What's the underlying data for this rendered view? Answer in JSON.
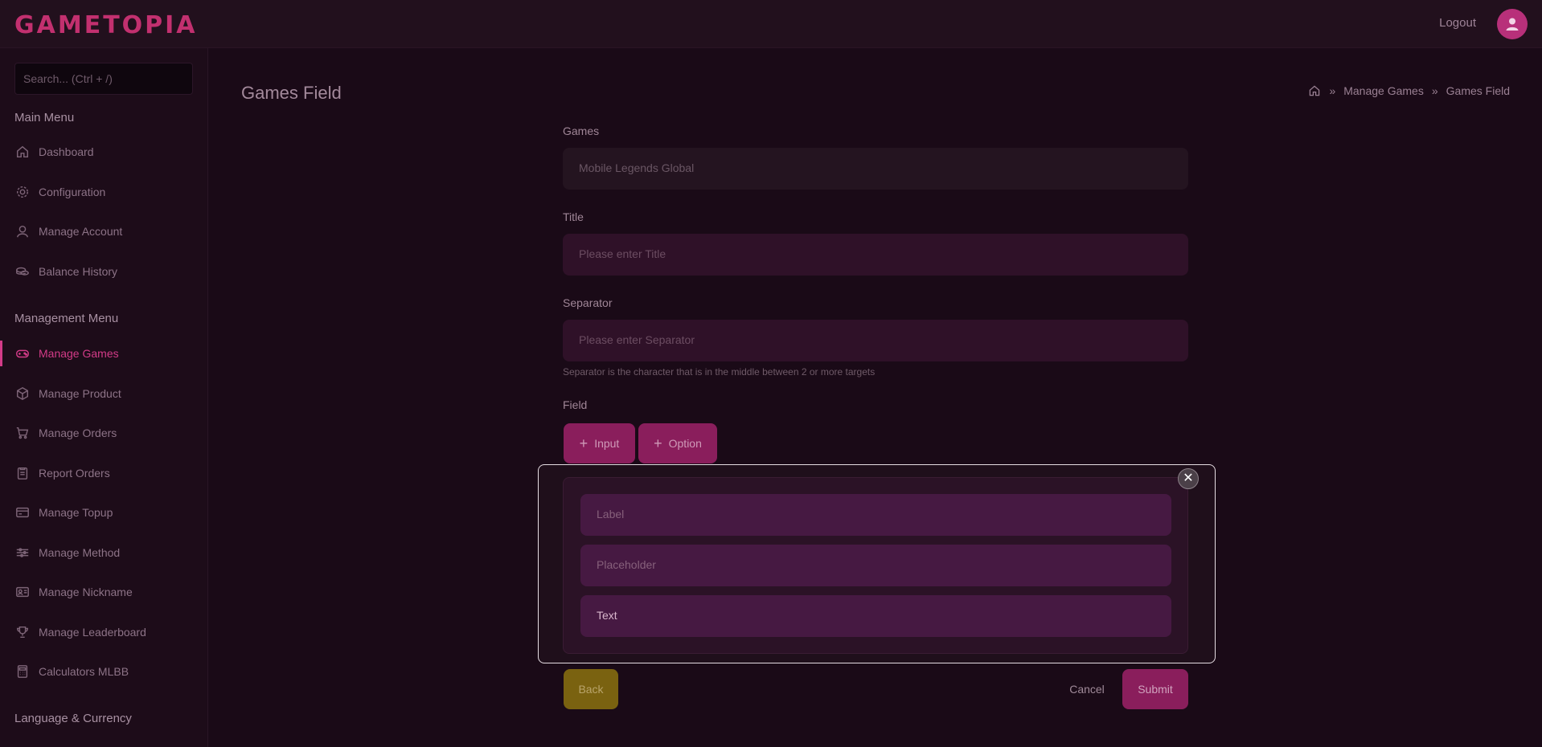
{
  "header": {
    "logo": "GAMETOPIA",
    "logout_label": "Logout",
    "avatar_icon": "user-icon"
  },
  "sidebar": {
    "search_placeholder": "Search... (Ctrl + /)",
    "main_menu_heading": "Main Menu",
    "main_items": [
      {
        "label": "Dashboard",
        "icon": "home-icon"
      },
      {
        "label": "Configuration",
        "icon": "gear-icon"
      },
      {
        "label": "Manage Account",
        "icon": "user-icon"
      },
      {
        "label": "Balance History",
        "icon": "coins-icon"
      }
    ],
    "management_heading": "Management Menu",
    "management_items": [
      {
        "label": "Manage Games",
        "icon": "gamepad-icon",
        "active": true
      },
      {
        "label": "Manage Product",
        "icon": "box-icon"
      },
      {
        "label": "Manage Orders",
        "icon": "cart-icon"
      },
      {
        "label": "Report Orders",
        "icon": "clipboard-icon"
      },
      {
        "label": "Manage Topup",
        "icon": "card-icon"
      },
      {
        "label": "Manage Method",
        "icon": "sliders-icon"
      },
      {
        "label": "Manage Nickname",
        "icon": "id-card-icon"
      },
      {
        "label": "Manage Leaderboard",
        "icon": "trophy-icon"
      },
      {
        "label": "Calculators MLBB",
        "icon": "calculator-icon"
      }
    ],
    "language_heading": "Language & Currency"
  },
  "main": {
    "page_title": "Games Field",
    "breadcrumb": [
      "Manage Games",
      "Games Field"
    ],
    "games_label": "Games",
    "games_value": "Mobile Legends Global",
    "title_label": "Title",
    "title_placeholder": "Please enter Title",
    "separator_label": "Separator",
    "separator_placeholder": "Please enter Separator",
    "separator_hint": "Separator is the character that is in the middle between 2 or more targets",
    "field_label": "Field",
    "add_input_label": "Input",
    "add_option_label": "Option",
    "field_row": {
      "label_placeholder": "Label",
      "placeholder_placeholder": "Placeholder",
      "type_value": "Text",
      "close_symbol": "✕"
    },
    "back_label": "Back",
    "cancel_label": "Cancel",
    "submit_label": "Submit"
  },
  "colors": {
    "accent": "#d33b88",
    "button": "#8a1e5c",
    "back_button": "#7a6210",
    "background": "#1a0a17"
  }
}
